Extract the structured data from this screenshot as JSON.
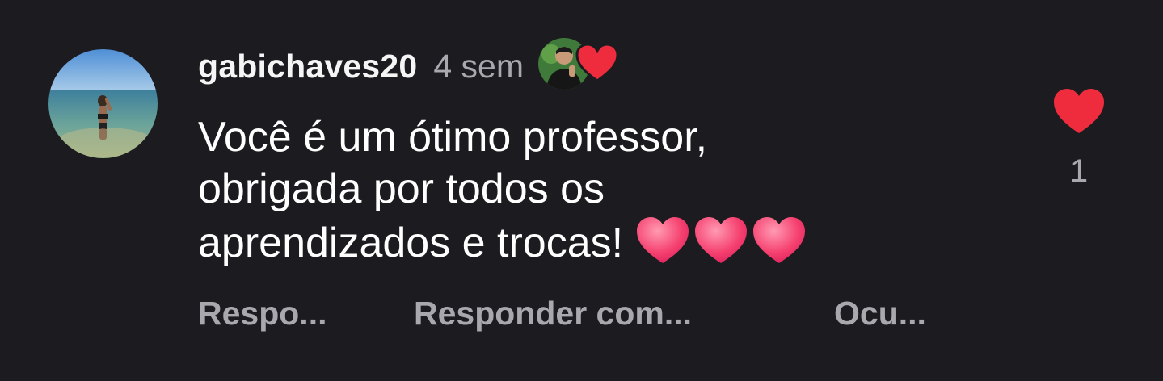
{
  "comment": {
    "username": "gabichaves20",
    "time": "4 sem",
    "text": "Você é um ótimo professor, obrigada por todos os aprendizados e trocas!",
    "line1": "Você é um ótimo professor,",
    "line2": "obrigada por todos os",
    "line3": "aprendizados e trocas!",
    "emojis": [
      "heart-emoji",
      "heart-emoji",
      "heart-emoji"
    ],
    "creator_liked": true,
    "like_count": "1",
    "liked": true
  },
  "actions": {
    "reply": "Respo...",
    "reply_with": "Responder com...",
    "hide": "Ocu..."
  },
  "colors": {
    "background": "#1c1c20",
    "text": "#ffffff",
    "secondary": "#a8a8ae",
    "heart": "#ef2c3d"
  },
  "icons": {
    "avatar": "user-avatar-beach-photo",
    "creator_avatar": "creator-avatar-photo",
    "like": "heart-icon"
  }
}
